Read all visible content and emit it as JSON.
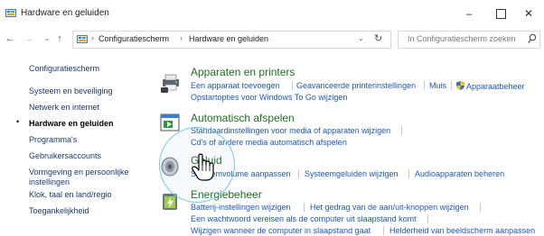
{
  "window": {
    "title": "Hardware en geluiden",
    "minimize": "–",
    "close": "✕"
  },
  "address": {
    "crumbs": [
      "Configuratiescherm",
      "Hardware en geluiden"
    ],
    "search_placeholder": "In Configuratiescherm zoeken"
  },
  "nav": {
    "home": "Configuratiescherm",
    "items": [
      "Systeem en beveiliging",
      "Netwerk en internet",
      "Hardware en geluiden",
      "Programma's",
      "Gebruikersaccounts",
      "Vormgeving en persoonlijke",
      "instellingen",
      "Klok, taal en land/regio",
      "Toegankelijkheid"
    ]
  },
  "categories": {
    "devices": {
      "title": "Apparaten en printers",
      "links": [
        "Een apparaat toevoegen",
        "Geavanceerde printerinstellingen",
        "Muis",
        "Apparaatbeheer",
        "Opstartopties voor Windows To Go wijzigen"
      ]
    },
    "autoplay": {
      "title": "Automatisch afspelen",
      "links": [
        "Standaardinstellingen voor media of apparaten wijzigen",
        "Cd's of andere media automatisch afspelen"
      ]
    },
    "sound": {
      "title": "Geluid",
      "links": [
        "Systeemvolume aanpassen",
        "Systeemgeluiden wijzigen",
        "Audioapparaten beheren"
      ]
    },
    "power": {
      "title": "Energiebeheer",
      "links": [
        "Batterij-instellingen wijzigen",
        "Het gedrag van de aan/uit-knoppen wijzigen",
        "Een wachtwoord vereisen als de computer uit slaapstand komt",
        "Wijzigen wanneer de computer in slaapstand gaat",
        "Helderheid van beeldscherm aanpassen"
      ]
    }
  },
  "colors": {
    "link": "#1e58b4",
    "category_title": "#1f6f1f",
    "highlight": "#79c8ea"
  }
}
